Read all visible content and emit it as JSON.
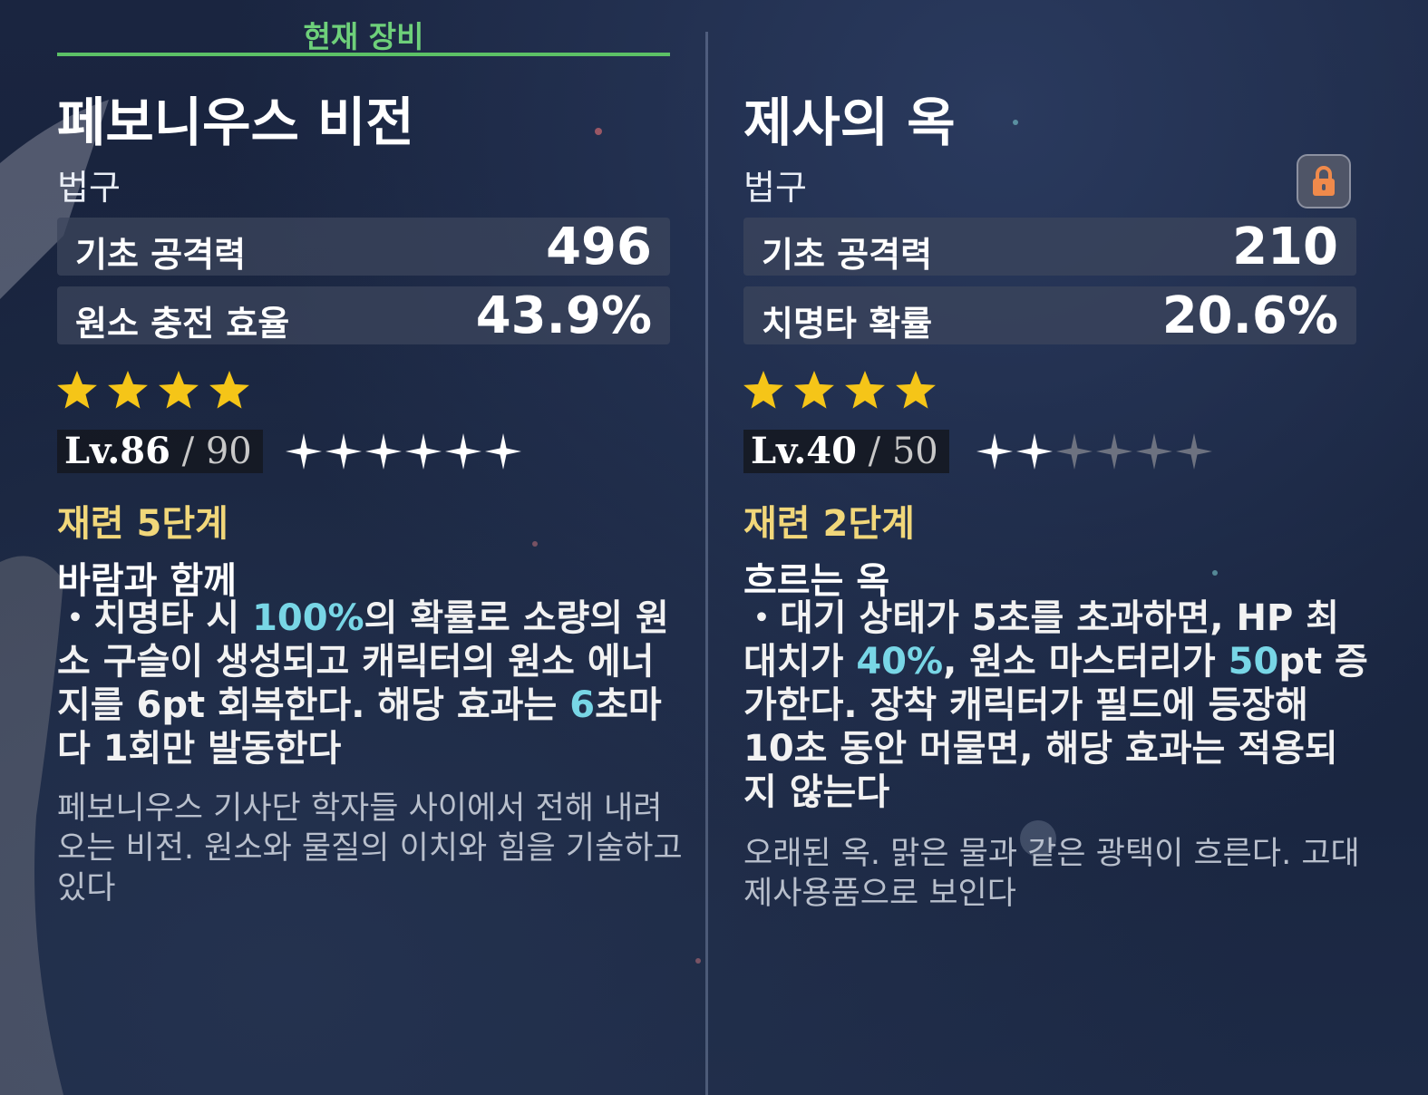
{
  "current": {
    "header": "현재 장비",
    "name": "페보니우스 비전",
    "type": "법구",
    "stats": [
      {
        "label": "기초 공격력",
        "value": "496"
      },
      {
        "label": "원소 충전 효율",
        "value": "43.9%"
      }
    ],
    "rarity": 4,
    "level": "Lv.86",
    "level_max": " / 90",
    "ascension_filled": 6,
    "ascension_total": 6,
    "refinement": "재련 5단계",
    "passive_name": "바람과 함께",
    "passive_desc": [
      {
        "t": "・치명타 시 ",
        "hl": false
      },
      {
        "t": "100%",
        "hl": true
      },
      {
        "t": "의 확률로 소량의 원소 구슬이 생성되고 캐릭터의 원소 에너지를 6pt 회복한다. 해당 효과는 ",
        "hl": false
      },
      {
        "t": "6",
        "hl": true
      },
      {
        "t": "초마다 1회만 발동한다",
        "hl": false
      }
    ],
    "lore": "페보니우스 기사단 학자들 사이에서 전해 내려오는 비전. 원소와 물질의 이치와 힘을 기술하고 있다"
  },
  "compare": {
    "name": "제사의 옥",
    "type": "법구",
    "lock_icon": "lock-icon",
    "stats": [
      {
        "label": "기초 공격력",
        "value": "210"
      },
      {
        "label": "치명타 확률",
        "value": "20.6%"
      }
    ],
    "rarity": 4,
    "level": "Lv.40",
    "level_max": " / 50",
    "ascension_filled": 2,
    "ascension_total": 6,
    "refinement": "재련 2단계",
    "passive_name": "흐르는 옥",
    "passive_desc": [
      {
        "t": "・대기 상태가 5초를 초과하면, HP 최대치가 ",
        "hl": false
      },
      {
        "t": "40%",
        "hl": true
      },
      {
        "t": ", 원소 마스터리가 ",
        "hl": false
      },
      {
        "t": "50",
        "hl": true
      },
      {
        "t": "pt 증가한다. 장착 캐릭터가 필드에 등장해 10초 동안 머물면, 해당 효과는 적용되지 않는다",
        "hl": false
      }
    ],
    "lore": "오래된 옥. 맑은 물과 같은 광택이 흐른다. 고대 제사용품으로 보인다"
  },
  "colors": {
    "equipped_green": "#5cc166",
    "refine_gold": "#f1d77a",
    "highlight_cyan": "#78d6e6",
    "star_gold": "#f5c518"
  }
}
